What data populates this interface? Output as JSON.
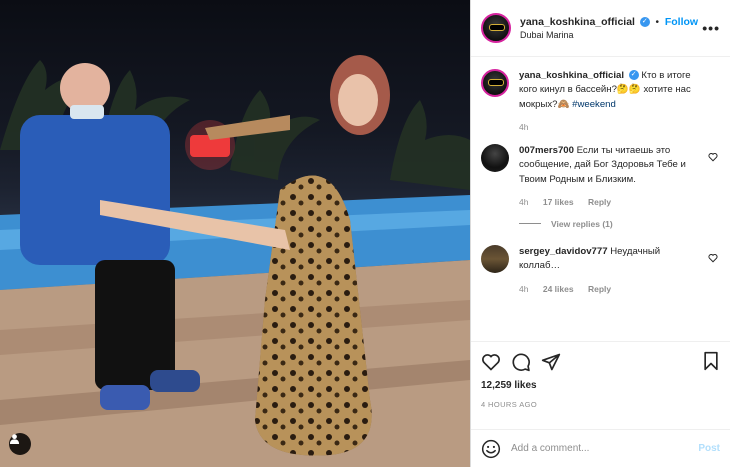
{
  "post": {
    "author": {
      "username": "yana_koshkina_official",
      "location": "Dubai Marina",
      "follow_label": "Follow",
      "dot": "•",
      "more": "•••"
    },
    "caption": {
      "username": "yana_koshkina_official",
      "text": "Кто в итоге кого кинул в бассейн?🤔🤔 хотите нас мокрых?🙈 ",
      "hashtag": "#weekend",
      "age": "4h"
    },
    "comments": [
      {
        "username": "007mers700",
        "text": "Если ты читаешь это сообщение, дай Бог Здоровья Тебе и Твоим Родным и Близким.",
        "age": "4h",
        "likes": "17 likes",
        "reply_label": "Reply",
        "view_replies": "View replies (1)"
      },
      {
        "username": "sergey_davidov777",
        "text": "Неудачный коллаб…",
        "age": "4h",
        "likes": "24 likes",
        "reply_label": "Reply"
      }
    ],
    "likes_count": "12,259 likes",
    "timestamp": "4 HOURS AGO",
    "comment_placeholder": "Add a comment...",
    "post_label": "Post"
  },
  "colors": {
    "accent": "#0095f6",
    "verified": "#3897f0",
    "muted": "#8e8e8e",
    "post_disabled": "#b2dffc"
  },
  "icons": [
    "user-tag-icon",
    "verified-icon",
    "more-options-icon",
    "heart-icon",
    "comment-icon",
    "share-icon",
    "bookmark-icon",
    "emoji-icon"
  ]
}
